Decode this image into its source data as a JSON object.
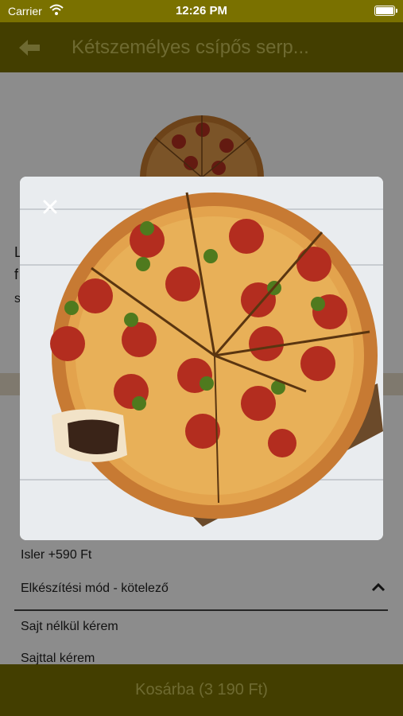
{
  "status_bar": {
    "carrier": "Carrier",
    "time": "12:26 PM"
  },
  "nav": {
    "title": "Kétszemélyes csípős serp..."
  },
  "description_fragments": [
    "L",
    "f",
    "s"
  ],
  "options_visible": {
    "partial_item": "Isler +590 Ft"
  },
  "section": {
    "title": "Elkészítési mód - kötelező",
    "items": [
      "Sajt nélkül kérem",
      "Sajttal kérem"
    ]
  },
  "footer": {
    "cart_button": "Kosárba (3 190 Ft)"
  },
  "icons": {
    "back": "arrow-left-icon",
    "close": "close-icon",
    "chevron": "chevron-up-icon",
    "wifi": "wifi-icon",
    "battery": "battery-icon"
  },
  "colors": {
    "brand": "#7a7100",
    "brand_text": "#c9c259"
  }
}
